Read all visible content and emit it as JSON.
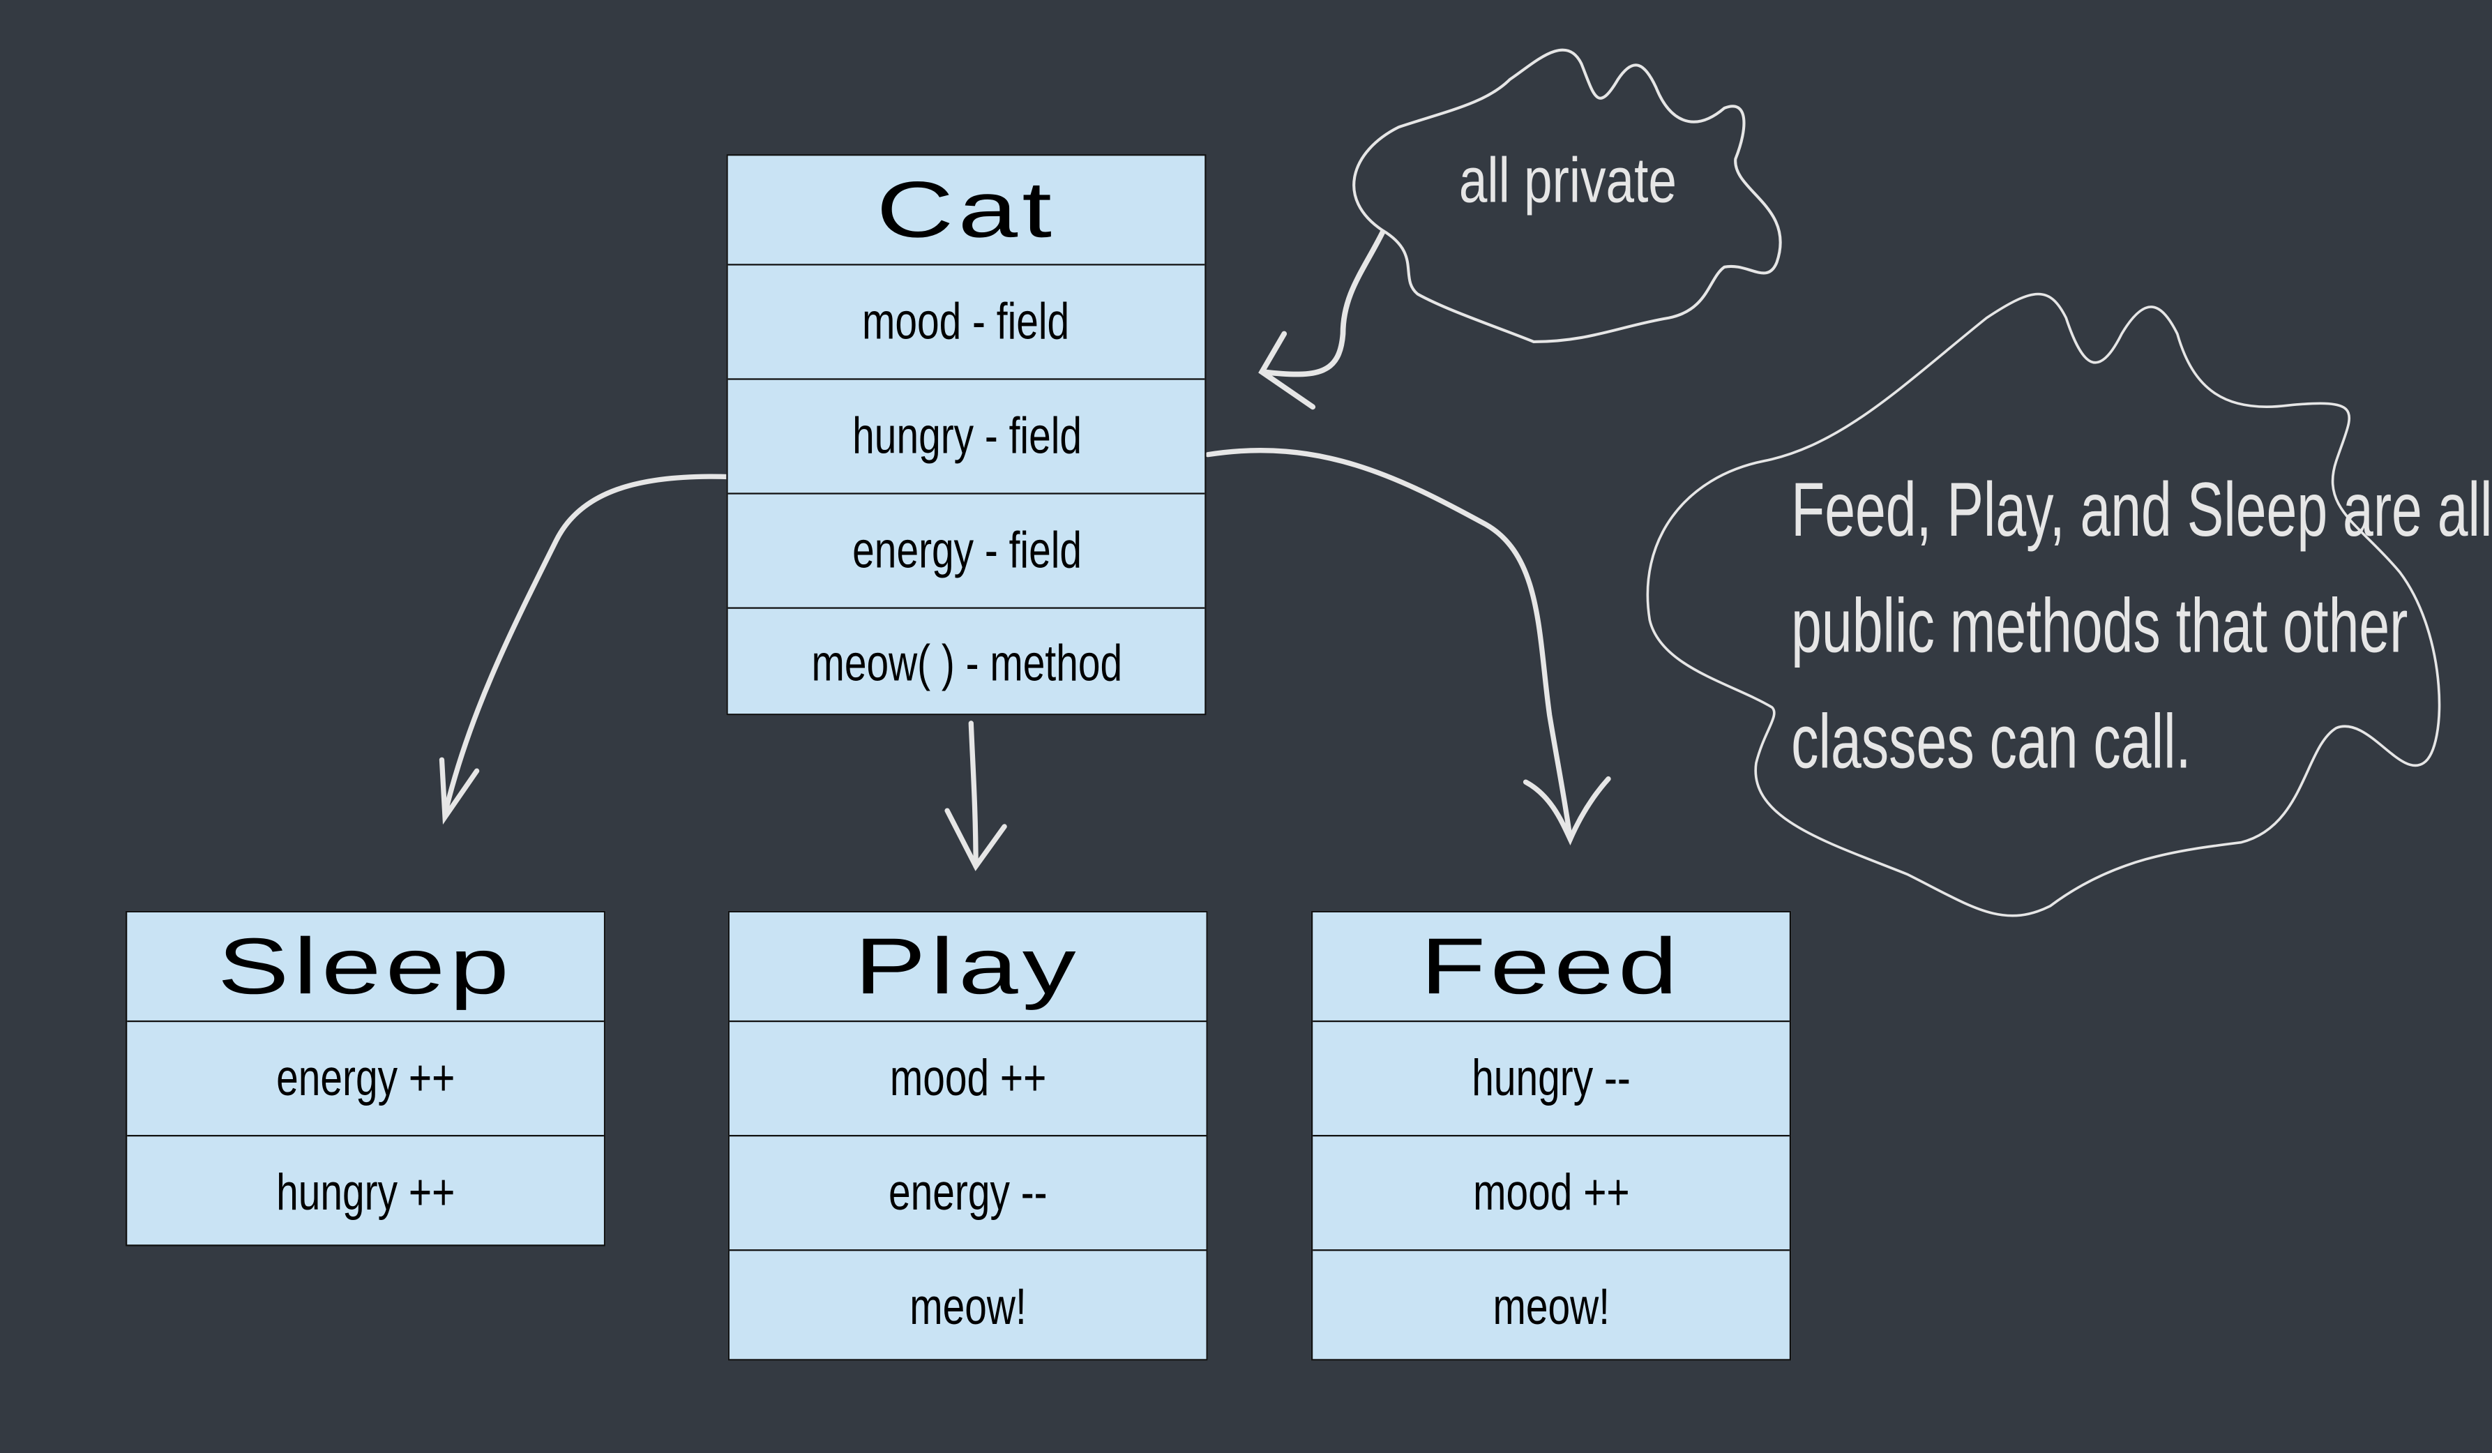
{
  "diagram": {
    "colors": {
      "background": "#343a42",
      "box_fill": "#c9e3f4",
      "box_border": "#111111",
      "annotation": "#e6e6e6"
    },
    "classes": {
      "cat": {
        "title": "Cat",
        "rows": [
          "mood - field",
          "hungry - field",
          "energy - field",
          "meow( ) - method"
        ]
      },
      "sleep": {
        "title": "Sleep",
        "rows": [
          "energy ++",
          "hungry ++"
        ]
      },
      "play": {
        "title": "Play",
        "rows": [
          "mood ++",
          "energy --",
          "meow!"
        ]
      },
      "feed": {
        "title": "Feed",
        "rows": [
          "hungry --",
          "mood ++",
          "meow!"
        ]
      }
    },
    "notes": {
      "private": "all private",
      "public": [
        "Feed, Play, and Sleep are all",
        "public methods that other",
        "classes can call."
      ]
    },
    "arrows": [
      {
        "from": "cat",
        "to": "sleep"
      },
      {
        "from": "cat",
        "to": "play"
      },
      {
        "from": "cat",
        "to": "feed"
      },
      {
        "from": "note-private",
        "to": "cat"
      }
    ]
  }
}
